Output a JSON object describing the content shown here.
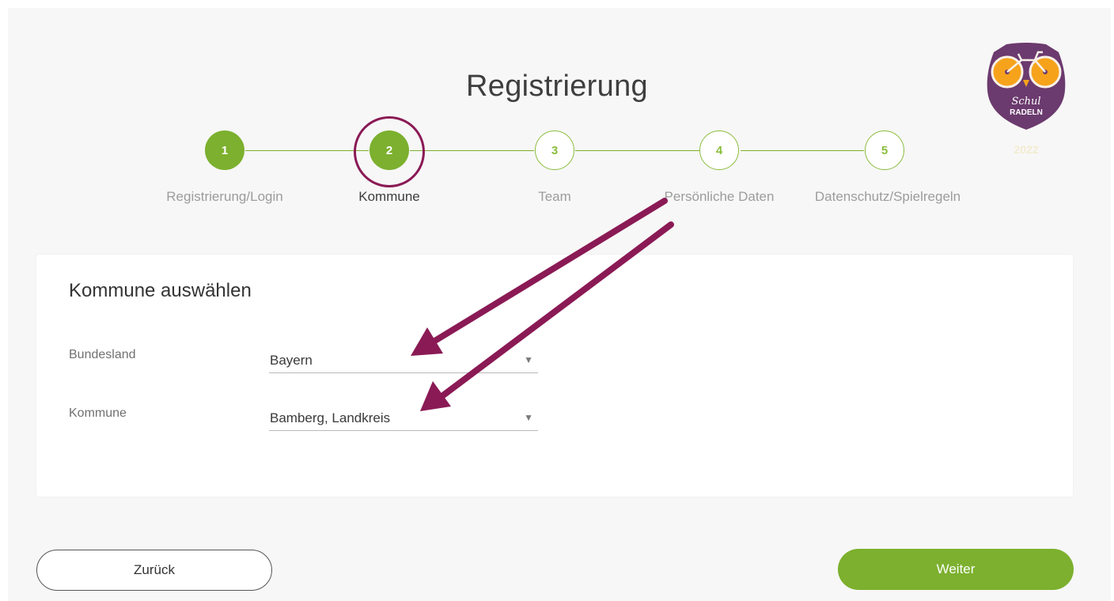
{
  "page": {
    "title": "Registrierung"
  },
  "steps": [
    {
      "number": "1",
      "label": "Registrierung/Login",
      "state": "done"
    },
    {
      "number": "2",
      "label": "Kommune",
      "state": "current"
    },
    {
      "number": "3",
      "label": "Team",
      "state": "todo"
    },
    {
      "number": "4",
      "label": "Persönliche Daten",
      "state": "todo"
    },
    {
      "number": "5",
      "label": "Datenschutz/Spielregeln",
      "state": "todo"
    }
  ],
  "logo": {
    "line1": "Schul",
    "line2": "RADELN",
    "year": "2022"
  },
  "form": {
    "title": "Kommune auswählen",
    "fields": [
      {
        "label": "Bundesland",
        "value": "Bayern"
      },
      {
        "label": "Kommune",
        "value": "Bamberg, Landkreis"
      }
    ]
  },
  "buttons": {
    "back": "Zurück",
    "next": "Weiter"
  },
  "colors": {
    "accent_green": "#7cb02e",
    "annotation": "#8a1a55",
    "logo_purple": "#6b3a6e",
    "logo_orange": "#f6a31b"
  },
  "icons": {
    "select_caret": "caret-down-icon",
    "logo": "owl-bicycle-logo"
  }
}
